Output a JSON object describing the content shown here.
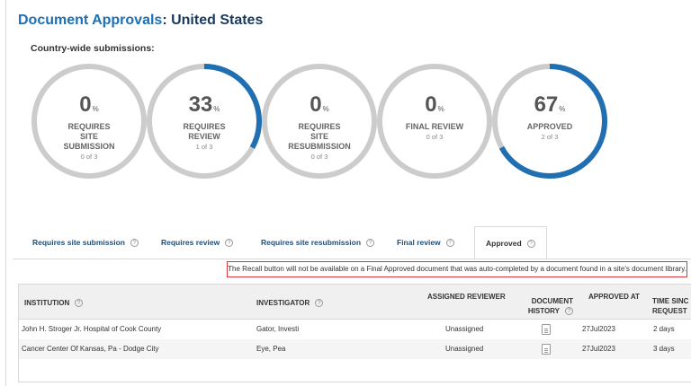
{
  "header": {
    "title_prefix": "Document Approvals",
    "title_suffix": ": United States",
    "subheading": "Country-wide submissions:"
  },
  "colors": {
    "accent": "#1f6fb2",
    "ring_bg": "#cccccc",
    "notice_border": "#d9363e"
  },
  "gauges": [
    {
      "value": "0",
      "percent": 0,
      "unit": "%",
      "line1": "REQUIRES",
      "line2": "SITE",
      "line3": "SUBMISSION",
      "count": "0 of 3"
    },
    {
      "value": "33",
      "percent": 33,
      "unit": "%",
      "line1": "REQUIRES",
      "line2": "REVIEW",
      "line3": "",
      "count": "1 of 3"
    },
    {
      "value": "0",
      "percent": 0,
      "unit": "%",
      "line1": "REQUIRES",
      "line2": "SITE",
      "line3": "RESUBMISSION",
      "count": "0 of 3"
    },
    {
      "value": "0",
      "percent": 0,
      "unit": "%",
      "line1": "FINAL REVIEW",
      "line2": "",
      "line3": "",
      "count": "0 of 3"
    },
    {
      "value": "67",
      "percent": 67,
      "unit": "%",
      "line1": "APPROVED",
      "line2": "",
      "line3": "",
      "count": "2 of 3"
    }
  ],
  "tabs": [
    {
      "label": "Requires site submission",
      "active": false
    },
    {
      "label": "Requires review",
      "active": false
    },
    {
      "label": "Requires site resubmission",
      "active": false
    },
    {
      "label": "Final review",
      "active": false
    },
    {
      "label": "Approved",
      "active": true
    }
  ],
  "notice": "The Recall button will not be available on a Final Approved document that was auto-completed by a document found in a site's document library.",
  "table": {
    "headers": {
      "institution": "INSTITUTION",
      "investigator": "INVESTIGATOR",
      "assigned_reviewer": "ASSIGNED REVIEWER",
      "document_history_1": "DOCUMENT",
      "document_history_2": "HISTORY",
      "approved_at": "APPROVED AT",
      "time_since_1": "TIME SINC",
      "time_since_2": "REQUEST"
    },
    "rows": [
      {
        "institution": "John H. Stroger Jr. Hospital of Cook County",
        "investigator": "Gator, Investi",
        "reviewer": "Unassigned",
        "approved_at": "27Jul2023",
        "time_since": "2 days"
      },
      {
        "institution": "Cancer Center Of Kansas, Pa - Dodge City",
        "investigator": "Eye, Pea",
        "reviewer": "Unassigned",
        "approved_at": "27Jul2023",
        "time_since": "3 days"
      }
    ]
  }
}
